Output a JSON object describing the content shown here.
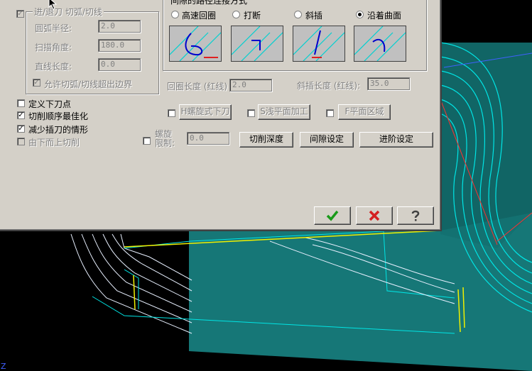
{
  "group_entry": {
    "title": "进/退刀  切弧/切线",
    "arc_radius": {
      "label": "圆弧半径:",
      "value": "2.0"
    },
    "sweep_angle": {
      "label": "扫描角度:",
      "value": "180.0"
    },
    "line_length": {
      "label": "直线长度:",
      "value": "0.0"
    },
    "allow_exceed": {
      "label": "允许切弧/切线超出边界",
      "checked": true
    }
  },
  "options": {
    "define_entry_point": {
      "label": "定义下刀点",
      "checked": false
    },
    "optimize_order": {
      "label": "切削顺序最佳化",
      "checked": true
    },
    "reduce_plunge": {
      "label": "减少插刀的情形",
      "checked": true
    },
    "bottom_up": {
      "label": "由下而上切削",
      "checked": false
    }
  },
  "link_group": {
    "title": "间隙的路径连接方式",
    "radios": [
      {
        "label": "高速回圈",
        "selected": false
      },
      {
        "label": "打断",
        "selected": false
      },
      {
        "label": "斜插",
        "selected": false
      },
      {
        "label": "沿着曲面",
        "selected": true
      }
    ],
    "loop_length": {
      "label": "回圈长度 (红线)",
      "value": "2.0"
    },
    "ramp_length": {
      "label": "斜插长度 (红线):",
      "value": "35.0"
    }
  },
  "toggles": {
    "helix_plunge": "H螺旋式下刀",
    "shallow_flat": "S浅平面加工",
    "flat_region": "F平面区域"
  },
  "helix_limit": {
    "label": "螺旋\n限制:",
    "value": "0.0"
  },
  "buttons": {
    "cut_depth": "切削深度",
    "gap_settings": "间隙设定",
    "advanced_settings": "进阶设定"
  },
  "dialog_buttons": {
    "ok_icon": "check-icon",
    "cancel_icon": "x-icon",
    "help_icon": "question-icon"
  },
  "viewport": {
    "axis_label": "Z"
  },
  "colors": {
    "dialog": "#d4d0c8",
    "toolpath": "#00e5e5",
    "ok_green": "#1a9a1a",
    "cancel_red": "#d42020"
  }
}
